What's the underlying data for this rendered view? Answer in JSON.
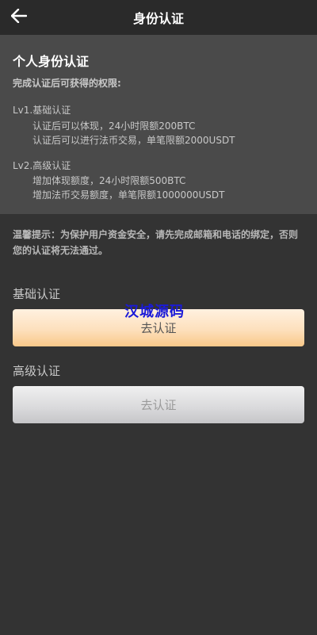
{
  "header": {
    "title": "身份认证",
    "back_icon": "arrow-left-icon"
  },
  "info": {
    "title": "个人身份认证",
    "subtitle": "完成认证后可获得的权限:",
    "levels": [
      {
        "title": "Lv1.基础认证",
        "items": [
          "认证后可以体现，24小时限额200BTC",
          "认证后可以进行法币交易，单笔限额2000USDT"
        ]
      },
      {
        "title": "Lv2.高级认证",
        "items": [
          "增加体现额度，24小时限额500BTC",
          "增加法币交易额度，单笔限额1000000USDT"
        ]
      }
    ]
  },
  "notice": "温馨提示：为保护用户资金安全，请先完成邮箱和电话的绑定，否则您的认证将无法通过。",
  "basic": {
    "label": "基础认证",
    "button": "去认证"
  },
  "advanced": {
    "label": "高级认证",
    "button": "去认证"
  },
  "watermark": "汉城源码",
  "colors": {
    "background": "#333333",
    "panel": "#4a4a4a",
    "primary_button": "#fde0bd",
    "disabled_button": "#d9d9db",
    "watermark": "#1a1ad8"
  }
}
